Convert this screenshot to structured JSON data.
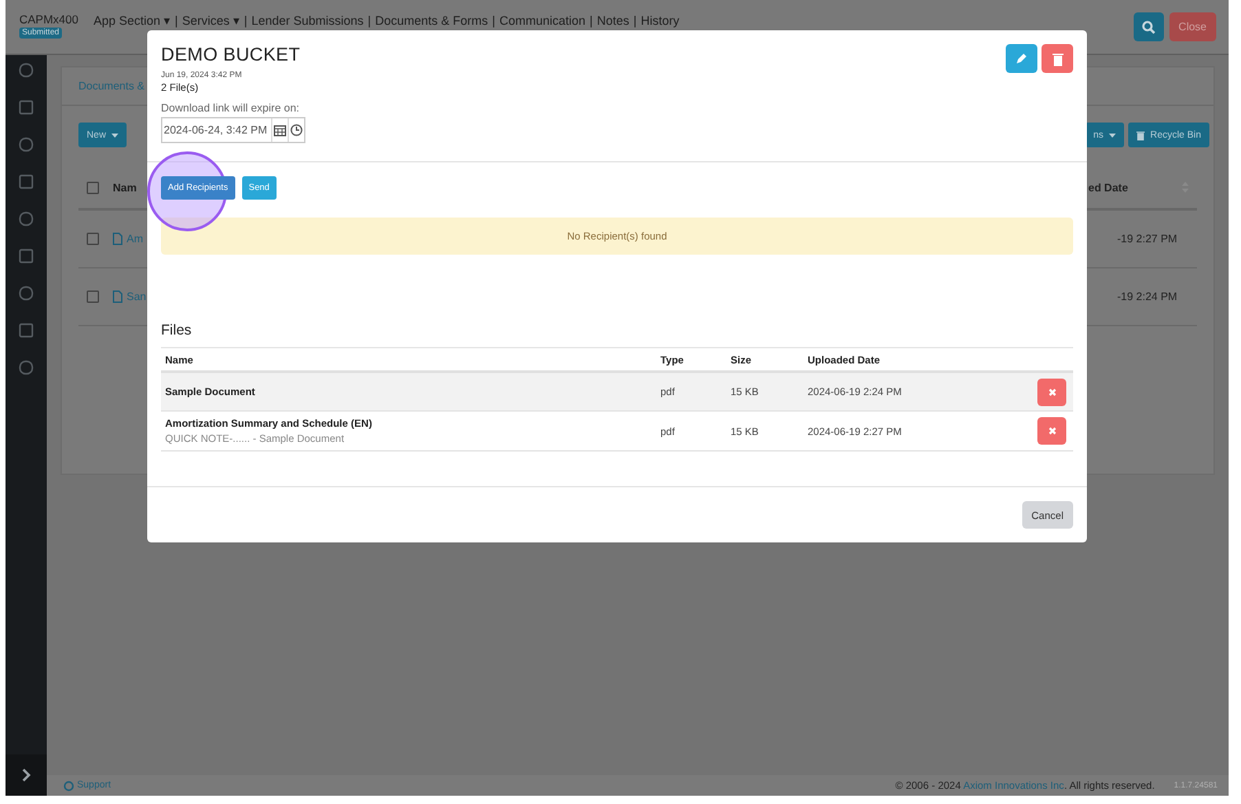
{
  "app": {
    "brand": "CAPMx400",
    "status_badge": "Submitted",
    "nav": [
      "App Section ▾",
      "|",
      "Services ▾",
      "|",
      "Lender Submissions",
      "|",
      "Documents & Forms",
      "|",
      "Communication",
      "|",
      "Notes",
      "|",
      "History"
    ],
    "close_button": "Close"
  },
  "background": {
    "tab": "Documents &",
    "new_button": "New",
    "actions_button": "ns",
    "recycle_button": "Recycle Bin",
    "header": {
      "checked": false,
      "name": "Nam",
      "date": "ed Date"
    },
    "rows": [
      {
        "checked": false,
        "name": "Am",
        "date": "-19 2:27 PM"
      },
      {
        "checked": false,
        "name": "San",
        "date": "-19 2:24 PM"
      }
    ]
  },
  "modal": {
    "title": "DEMO BUCKET",
    "created": "Jun 19, 2024 3:42 PM",
    "file_count": "2 File(s)",
    "expiry_label": "Download link will expire on:",
    "expiry_value": "2024-06-24, 3:42 PM",
    "add_button": "Add Recipients",
    "send_button": "Send",
    "alert": "No Recipient(s) found",
    "files_heading": "Files",
    "columns": [
      "Name",
      "Type",
      "Size",
      "Uploaded Date"
    ],
    "files": [
      {
        "name": "Sample Document",
        "type": "pdf",
        "size": "15 KB",
        "uploaded": "2024-06-19 2:24 PM",
        "highlighted": true
      },
      {
        "name": "Amortization Summary and Schedule (EN)",
        "note": "QUICK NOTE-...... - Sample Document",
        "type": "pdf",
        "size": "15 KB",
        "uploaded": "2024-06-19 2:27 PM",
        "highlighted": false
      }
    ],
    "cancel_button": "Cancel"
  },
  "click_marker": {
    "on": true
  },
  "footer": {
    "support": "Support",
    "copyright": "© 2006 - 2024 ",
    "company": "Axiom Innovations Inc",
    "rights": ". All rights reserved.",
    "version": "1.1.7.24581"
  }
}
